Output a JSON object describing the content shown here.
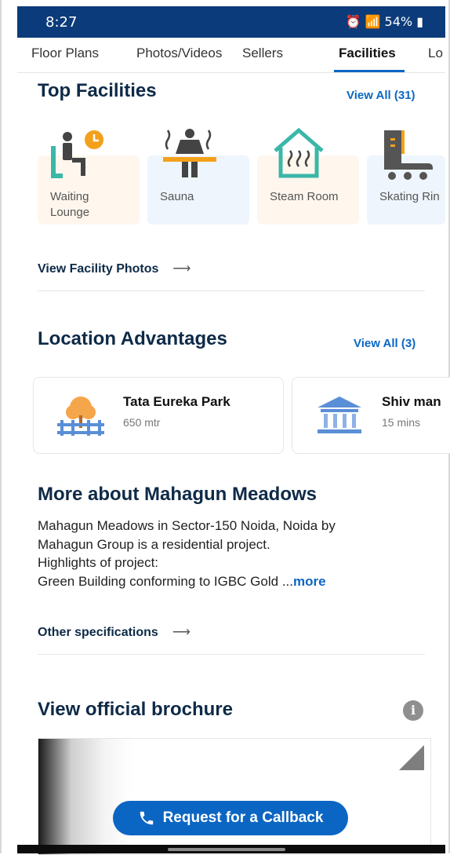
{
  "status": {
    "time": "8:27",
    "battery": "54%"
  },
  "tabs": [
    {
      "label": "Floor Plans"
    },
    {
      "label": "Photos/Videos"
    },
    {
      "label": "Sellers"
    },
    {
      "label": "Facilities"
    },
    {
      "label": "Lo"
    }
  ],
  "top_facilities": {
    "title": "Top Facilities",
    "view_all": "View All (31)",
    "items": [
      {
        "label": "Waiting Lounge",
        "icon": "waiting-lounge-icon"
      },
      {
        "label": "Sauna",
        "icon": "sauna-icon"
      },
      {
        "label": "Steam Room",
        "icon": "steam-room-icon"
      },
      {
        "label": "Skating Rin",
        "icon": "skating-rink-icon"
      }
    ],
    "photos_link": "View Facility Photos"
  },
  "location_advantages": {
    "title": "Location Advantages",
    "view_all": "View All (3)",
    "items": [
      {
        "name": "Tata Eureka Park",
        "distance": "650 mtr",
        "icon": "park-icon"
      },
      {
        "name": "Shiv man",
        "distance": "15 mins",
        "icon": "temple-icon"
      }
    ]
  },
  "about": {
    "title": "More about Mahagun Meadows",
    "line1": "Mahagun Meadows in Sector-150 Noida, Noida by",
    "line2": "Mahagun Group is a residential project.",
    "line3": "Highlights of project:",
    "line4": "Green Building conforming to IGBC Gold ...",
    "more": "more",
    "specs_link": "Other specifications"
  },
  "brochure": {
    "title": "View official brochure",
    "info_icon": "info-icon"
  },
  "cta": {
    "label": "Request for a Callback",
    "icon": "phone-icon"
  },
  "colors": {
    "primary": "#0b66c3",
    "heading": "#0e2a47",
    "status_bar": "#0b3b7a"
  }
}
